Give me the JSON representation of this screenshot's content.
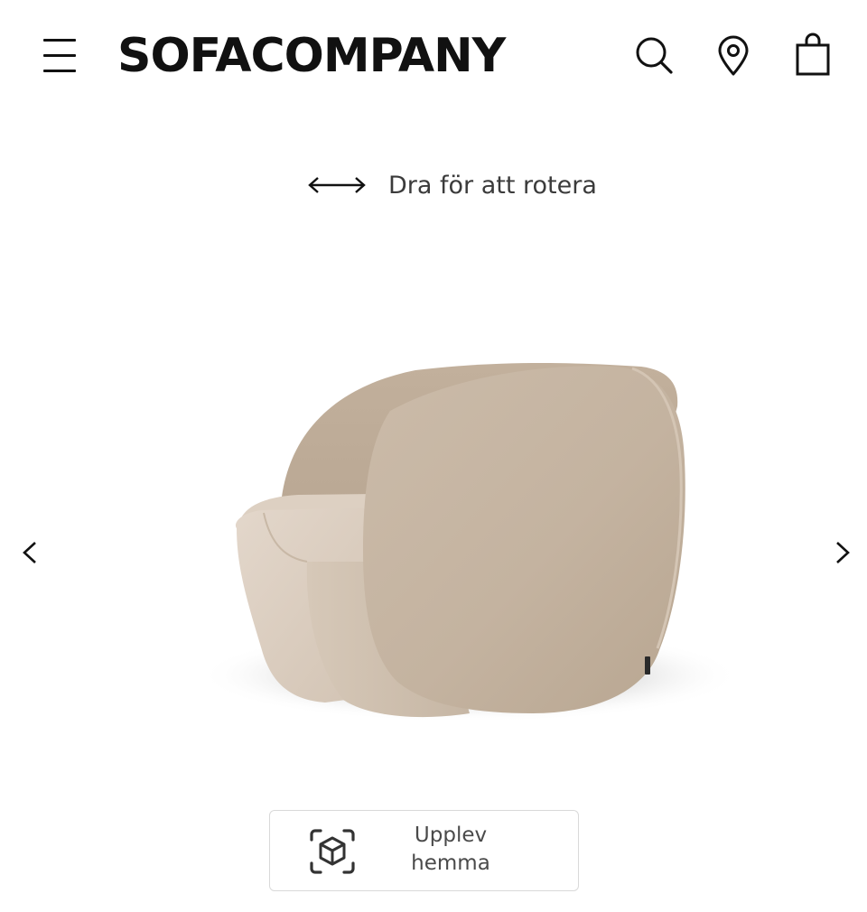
{
  "header": {
    "logo": "SOFACOMPANY",
    "icons": {
      "menu": "hamburger-menu-icon",
      "search": "search-icon",
      "store_locator": "location-pin-icon",
      "cart": "shopping-bag-icon"
    }
  },
  "viewer": {
    "rotate_hint": "Dra för att rotera",
    "rotate_icon": "double-arrow-horizontal-icon",
    "prev_icon": "chevron-left-icon",
    "next_icon": "chevron-right-icon",
    "product_image": "beige-velvet-armchair"
  },
  "ar_button": {
    "label_line1": "Upplev",
    "label_line2": "hemma",
    "icon": "ar-cube-icon"
  },
  "colors": {
    "text": "#111111",
    "fabric": "#c8b8a6",
    "border": "#d9d9d9"
  }
}
